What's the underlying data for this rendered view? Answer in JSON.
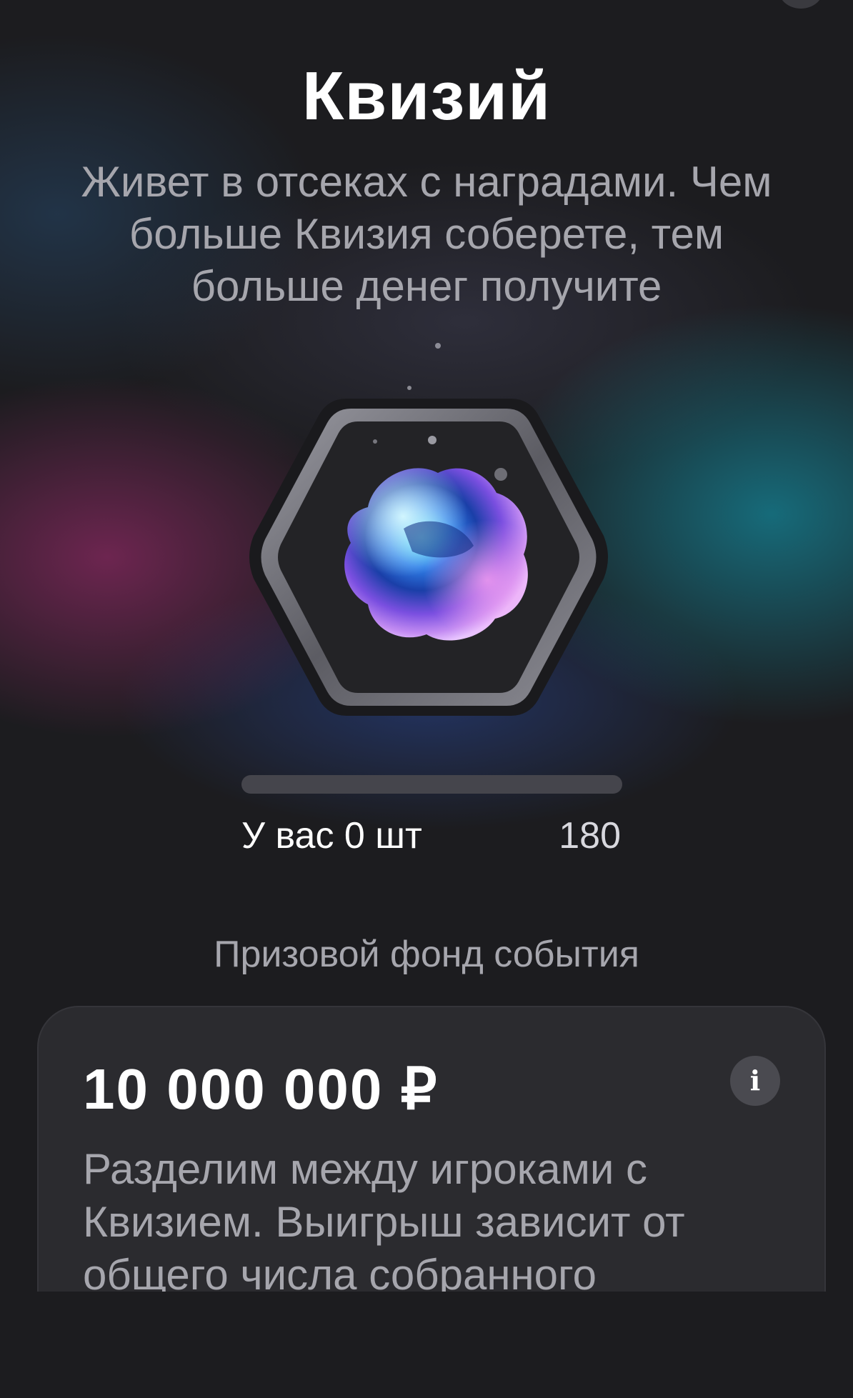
{
  "header": {
    "title": "Квизий",
    "subtitle": "Живет в отсеках с наградами. Чем больше Квизия соберете, тем больше денег получите"
  },
  "badge": {
    "icon": "iridescent-gem-icon"
  },
  "progress": {
    "current": 0,
    "goal": 180,
    "fraction": 0,
    "count_label": "У вас 0 шт",
    "goal_label": "180"
  },
  "prize_fund": {
    "section_title": "Призовой фонд события",
    "amount": "10 000 000 ₽",
    "info_icon": "info-icon",
    "info_glyph": "i",
    "description": "Разделим между игроками с Квизием. Выигрыш зависит от общего числа собранного"
  },
  "colors": {
    "background": "#1c1c1f",
    "card": "#2b2b2f",
    "muted_text": "#a6a6ad",
    "progress_track": "#45454c"
  }
}
